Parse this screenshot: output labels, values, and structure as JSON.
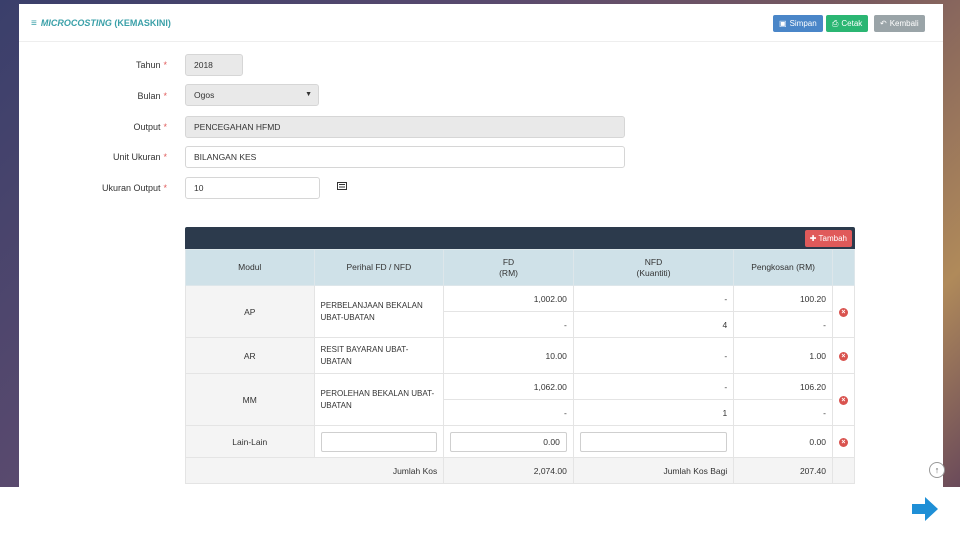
{
  "header": {
    "menu_icon": "hamburger-icon",
    "title_main": "MICROCOSTING",
    "title_sub": "(KEMASKINI)",
    "save_label": "Simpan",
    "print_label": "Cetak",
    "back_label": "Kembali"
  },
  "form": {
    "year_label": "Tahun",
    "year_value": "2018",
    "month_label": "Bulan",
    "month_value": "Ogos",
    "output_label": "Output",
    "output_value": "PENCEGAHAN HFMD",
    "unit_label": "Unit Ukuran",
    "unit_value": "BILANGAN KES",
    "size_label": "Ukuran Output",
    "size_value": "10",
    "required_mark": "*"
  },
  "table": {
    "add_label": "Tambah",
    "headers": {
      "modul": "Modul",
      "perihal": "Perihal FD / NFD",
      "fd_line1": "FD",
      "fd_line2": "(RM)",
      "nfd_line1": "NFD",
      "nfd_line2": "(Kuantiti)",
      "cost": "Pengkosan (RM)"
    },
    "rows": [
      {
        "modul": "AP",
        "perihal": "PERBELANJAAN BEKALAN UBAT-UBATAN",
        "fd1": "1,002.00",
        "nfd1": "-",
        "cost1": "100.20",
        "fd2": "-",
        "nfd2": "4",
        "cost2": "-"
      },
      {
        "modul": "AR",
        "perihal": "RESIT BAYARAN UBAT-UBATAN",
        "fd": "10.00",
        "nfd": "-",
        "cost": "1.00"
      },
      {
        "modul": "MM",
        "perihal": "PEROLEHAN BEKALAN UBAT-UBATAN",
        "fd1": "1,062.00",
        "nfd1": "-",
        "cost1": "106.20",
        "fd2": "-",
        "nfd2": "1",
        "cost2": "-"
      }
    ],
    "lain": {
      "modul": "Lain-Lain",
      "fd_value": "0.00",
      "cost": "0.00"
    },
    "total": {
      "label": "Jumlah Kos",
      "fd": "2,074.00",
      "nfd_label": "Jumlah Kos Bagi",
      "cost": "207.40"
    }
  }
}
